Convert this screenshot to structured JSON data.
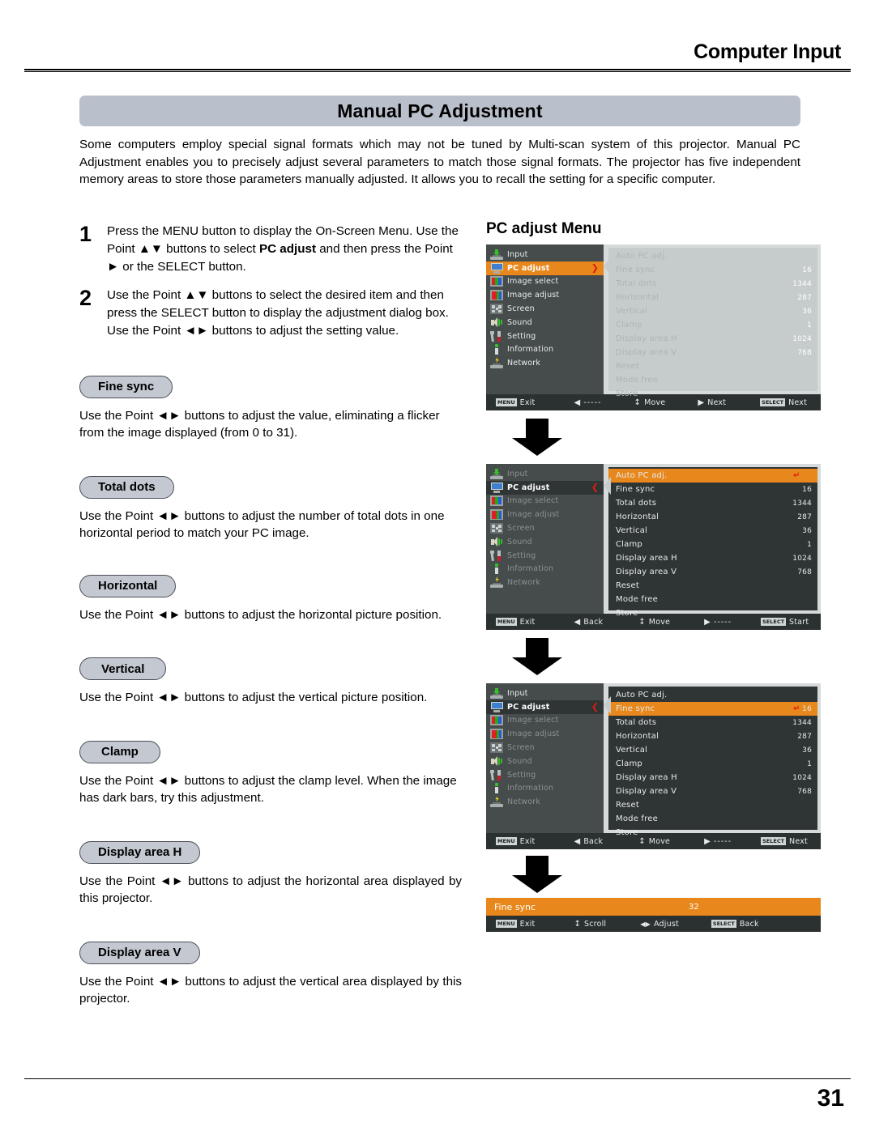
{
  "header": {
    "section_title": "Computer Input"
  },
  "banner": {
    "title": "Manual PC Adjustment"
  },
  "intro": {
    "paragraph": "Some computers employ special signal formats which may not be tuned by Multi-scan system of this projector. Manual PC Adjustment enables you to precisely adjust several parameters to match those signal formats. The projector has five independent memory areas to store those parameters manually adjusted. It allows you to recall the setting for a specific computer."
  },
  "steps": [
    {
      "number": "1",
      "text_before": "Press the MENU button to display the On-Screen Menu. Use the Point ▲▼ buttons to select ",
      "bold": "PC adjust",
      "text_after": " and then press the Point ► or the SELECT button."
    },
    {
      "number": "2",
      "text_before": "Use the Point ▲▼ buttons to select  the desired item and then press the SELECT button to display the adjustment dialog box. Use the Point ◄► buttons to adjust the setting value.",
      "bold": "",
      "text_after": ""
    }
  ],
  "sections": [
    {
      "label": "Fine sync",
      "desc": "Use the Point ◄► buttons to adjust the value, eliminating a flicker from the image displayed (from 0 to 31)."
    },
    {
      "label": "Total dots",
      "desc": "Use the Point ◄► buttons to adjust the number of total dots in one horizontal period to match your PC image."
    },
    {
      "label": "Horizontal",
      "desc": "Use the Point ◄► buttons to adjust the horizontal picture position."
    },
    {
      "label": "Vertical",
      "desc": "Use the Point ◄► buttons to adjust the vertical picture position."
    },
    {
      "label": "Clamp",
      "desc": "Use the Point ◄► buttons to adjust the clamp level. When the image has dark bars, try this adjustment."
    },
    {
      "label": "Display area H",
      "desc": "Use the Point ◄► buttons to adjust the horizontal area displayed by this projector."
    },
    {
      "label": "Display area V",
      "desc": "Use the Point ◄► buttons to adjust the vertical area displayed by this projector."
    }
  ],
  "osd": {
    "title": "PC adjust Menu",
    "sidebar": [
      {
        "label": "Input",
        "icon": "input-icon"
      },
      {
        "label": "PC adjust",
        "icon": "pc-adjust-icon"
      },
      {
        "label": "Image select",
        "icon": "image-select-icon"
      },
      {
        "label": "Image adjust",
        "icon": "image-adjust-icon"
      },
      {
        "label": "Screen",
        "icon": "screen-icon"
      },
      {
        "label": "Sound",
        "icon": "sound-icon"
      },
      {
        "label": "Setting",
        "icon": "setting-icon"
      },
      {
        "label": "Information",
        "icon": "information-icon"
      },
      {
        "label": "Network",
        "icon": "network-icon"
      }
    ],
    "items": [
      {
        "label": "Auto PC adj.",
        "value": ""
      },
      {
        "label": "Fine sync",
        "value": "16"
      },
      {
        "label": "Total dots",
        "value": "1344"
      },
      {
        "label": "Horizontal",
        "value": "287"
      },
      {
        "label": "Vertical",
        "value": "36"
      },
      {
        "label": "Clamp",
        "value": "1"
      },
      {
        "label": "Display area H",
        "value": "1024"
      },
      {
        "label": "Display area V",
        "value": "768"
      },
      {
        "label": "Reset",
        "value": ""
      },
      {
        "label": "Mode free",
        "value": ""
      },
      {
        "label": "Store",
        "value": ""
      }
    ],
    "caret_right": "❯",
    "caret_left": "❮",
    "return_glyph": "↵",
    "guides": {
      "menu_key": "MENU",
      "select_key": "SELECT",
      "exit": "Exit",
      "back": "Back",
      "move": "Move",
      "next": "Next",
      "start": "Start",
      "scroll": "Scroll",
      "adjust": "Adjust",
      "dashes": "-----",
      "left_arrow": "◀",
      "right_arrow": "▶",
      "updown_arrow": "↕",
      "leftright_arrow": "◀▶"
    },
    "dialog": {
      "label": "Fine sync",
      "value": "32"
    }
  },
  "footer": {
    "page_number": "31"
  }
}
